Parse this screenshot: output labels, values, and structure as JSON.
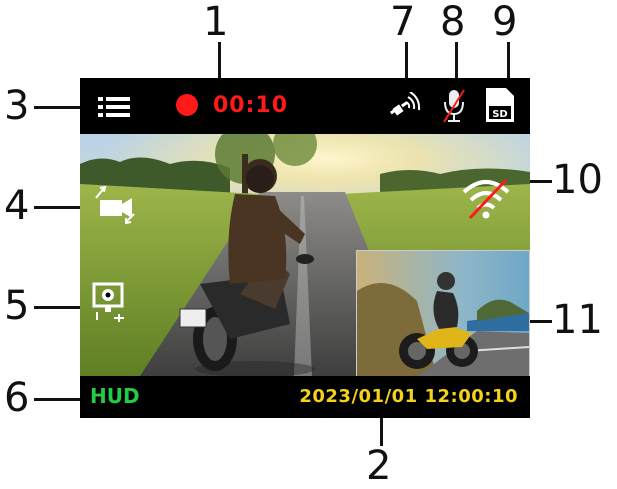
{
  "callouts": [
    "1",
    "2",
    "3",
    "4",
    "5",
    "6",
    "7",
    "8",
    "9",
    "10",
    "11"
  ],
  "status_bar": {
    "recording_time": "00:10",
    "recording_color": "#ff1a1a"
  },
  "bottom_bar": {
    "hud_label": "HUD",
    "hud_color": "#22cc44",
    "datetime": "2023/01/01 12:00:10",
    "datetime_color": "#f2d21a"
  },
  "icons": {
    "menu": "menu-list-icon",
    "gps": "gps-satellite-icon",
    "mic": "microphone-muted-icon",
    "sd": "sd-card-icon",
    "camera_switch": "camera-switch-icon",
    "parking": "parking-monitor-icon",
    "wifi": "wifi-off-icon"
  },
  "sd_label": "SD"
}
